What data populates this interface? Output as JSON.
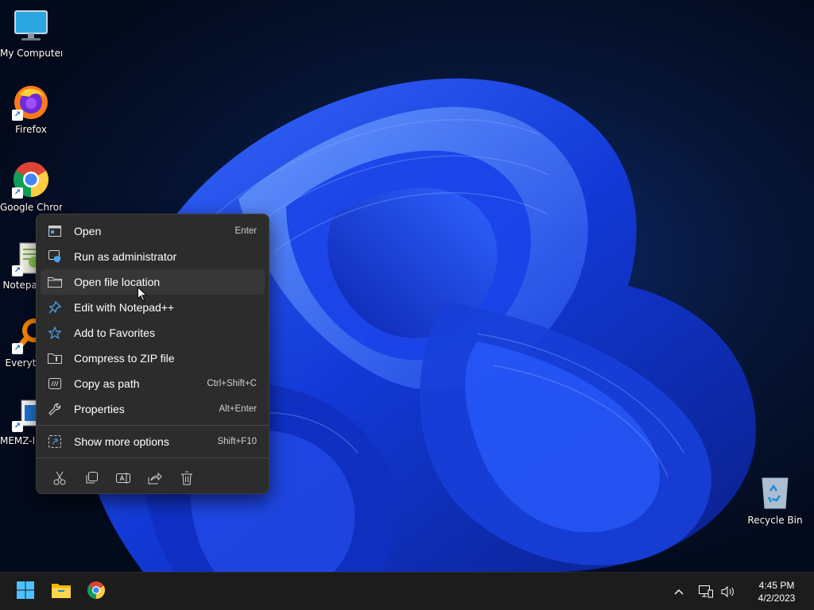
{
  "desktop": {
    "icons": [
      {
        "label": "My Computer",
        "icon": "monitor-icon"
      },
      {
        "label": "Firefox",
        "icon": "firefox-icon"
      },
      {
        "label": "Google Chrome",
        "icon": "chrome-icon"
      },
      {
        "label": "Notepad++",
        "icon": "notepadpp-icon"
      },
      {
        "label": "Everything",
        "icon": "search-magnifier-icon"
      },
      {
        "label": "MEMZ-Installer",
        "icon": "app-window-icon"
      },
      {
        "label": "Recycle Bin",
        "icon": "recycle-bin-icon"
      }
    ]
  },
  "context_menu": {
    "items": [
      {
        "label": "Open",
        "shortcut": "Enter",
        "icon": "open-window-icon"
      },
      {
        "label": "Run as administrator",
        "shortcut": "",
        "icon": "shield-icon"
      },
      {
        "label": "Open file location",
        "shortcut": "",
        "icon": "folder-icon"
      },
      {
        "label": "Edit with Notepad++",
        "shortcut": "",
        "icon": "pin-icon"
      },
      {
        "label": "Add to Favorites",
        "shortcut": "",
        "icon": "star-icon"
      },
      {
        "label": "Compress to ZIP file",
        "shortcut": "",
        "icon": "zip-folder-icon"
      },
      {
        "label": "Copy as path",
        "shortcut": "Ctrl+Shift+C",
        "icon": "copy-path-icon"
      },
      {
        "label": "Properties",
        "shortcut": "Alt+Enter",
        "icon": "wrench-icon"
      },
      {
        "label": "Show more options",
        "shortcut": "Shift+F10",
        "icon": "more-options-icon"
      }
    ],
    "hovered_item": "Open file location",
    "actions": [
      "cut-icon",
      "copy-icon",
      "rename-icon",
      "share-icon",
      "delete-icon"
    ]
  },
  "taskbar": {
    "apps": [
      "start-icon",
      "file-explorer-icon",
      "chrome-icon"
    ],
    "tray": [
      "chevron-up-icon",
      "network-icon",
      "volume-icon"
    ],
    "time": "4:45 PM",
    "date": "4/2/2023"
  },
  "colors": {
    "menu_bg": "#2c2c2c",
    "menu_hover": "#373737",
    "taskbar_bg": "#1c1c1c",
    "accent": "#4aa3f0"
  }
}
